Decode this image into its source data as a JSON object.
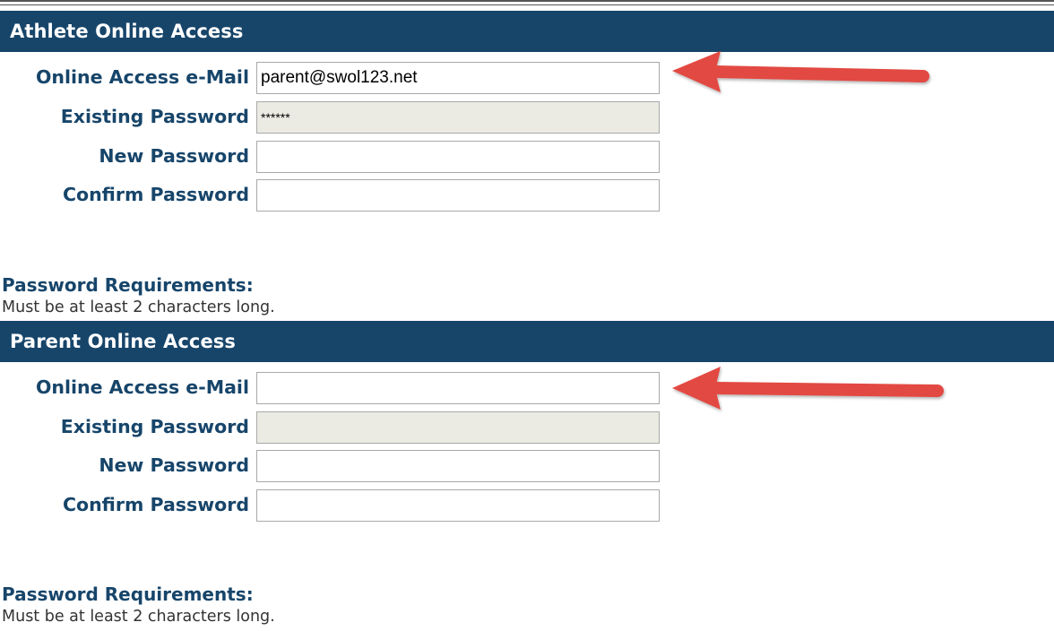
{
  "athlete": {
    "header": "Athlete Online Access",
    "email_label": "Online Access e-Mail",
    "email_value": "parent@swol123.net",
    "existing_password_label": "Existing Password",
    "existing_password_value": "******",
    "new_password_label": "New Password",
    "new_password_value": "",
    "confirm_password_label": "Confirm Password",
    "confirm_password_value": "",
    "requirements_title": "Password Requirements:",
    "requirements_text": "Must be at least 2 characters long."
  },
  "parent": {
    "header": "Parent Online Access",
    "email_label": "Online Access e-Mail",
    "email_value": "",
    "existing_password_label": "Existing Password",
    "existing_password_value": "",
    "new_password_label": "New Password",
    "new_password_value": "",
    "confirm_password_label": "Confirm Password",
    "confirm_password_value": "",
    "requirements_title": "Password Requirements:",
    "requirements_text": "Must be at least 2 characters long."
  },
  "colors": {
    "header_bg": "#17456a",
    "label_text": "#17456a",
    "arrow": "#e24a42",
    "readonly_bg": "#ebebe4"
  },
  "icons": {
    "annotation_arrow": "left-pointing-arrow"
  }
}
